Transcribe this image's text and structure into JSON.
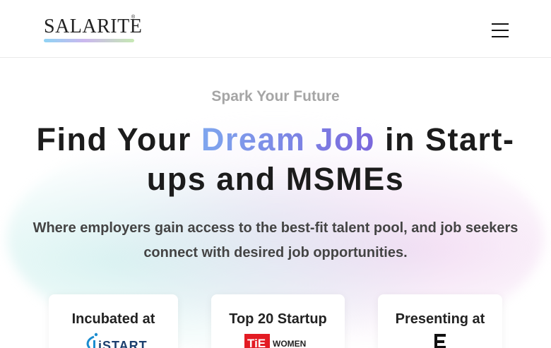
{
  "header": {
    "logo_text": "SALARITE",
    "logo_mark": "®",
    "menu_icon": "hamburger-menu-icon"
  },
  "hero": {
    "eyebrow": "Spark Your Future",
    "headline_part1": "Find Your ",
    "headline_highlight": "Dream Job",
    "headline_part2": " in Start-ups and MSMEs",
    "tagline": "Where employers gain access to the best-fit talent pool, and job seekers connect with desired job opportunities."
  },
  "cards": [
    {
      "title": "Incubated at",
      "logo_text": "iSTART"
    },
    {
      "title": "Top 20 Startup",
      "logo_text": "WOMEN"
    },
    {
      "title": "Presenting at",
      "logo_text": ""
    }
  ],
  "colors": {
    "highlight_start": "#7fa6ee",
    "highlight_end": "#7a67dc",
    "eyebrow": "#a5a5a5",
    "text": "#1c1c1c"
  }
}
